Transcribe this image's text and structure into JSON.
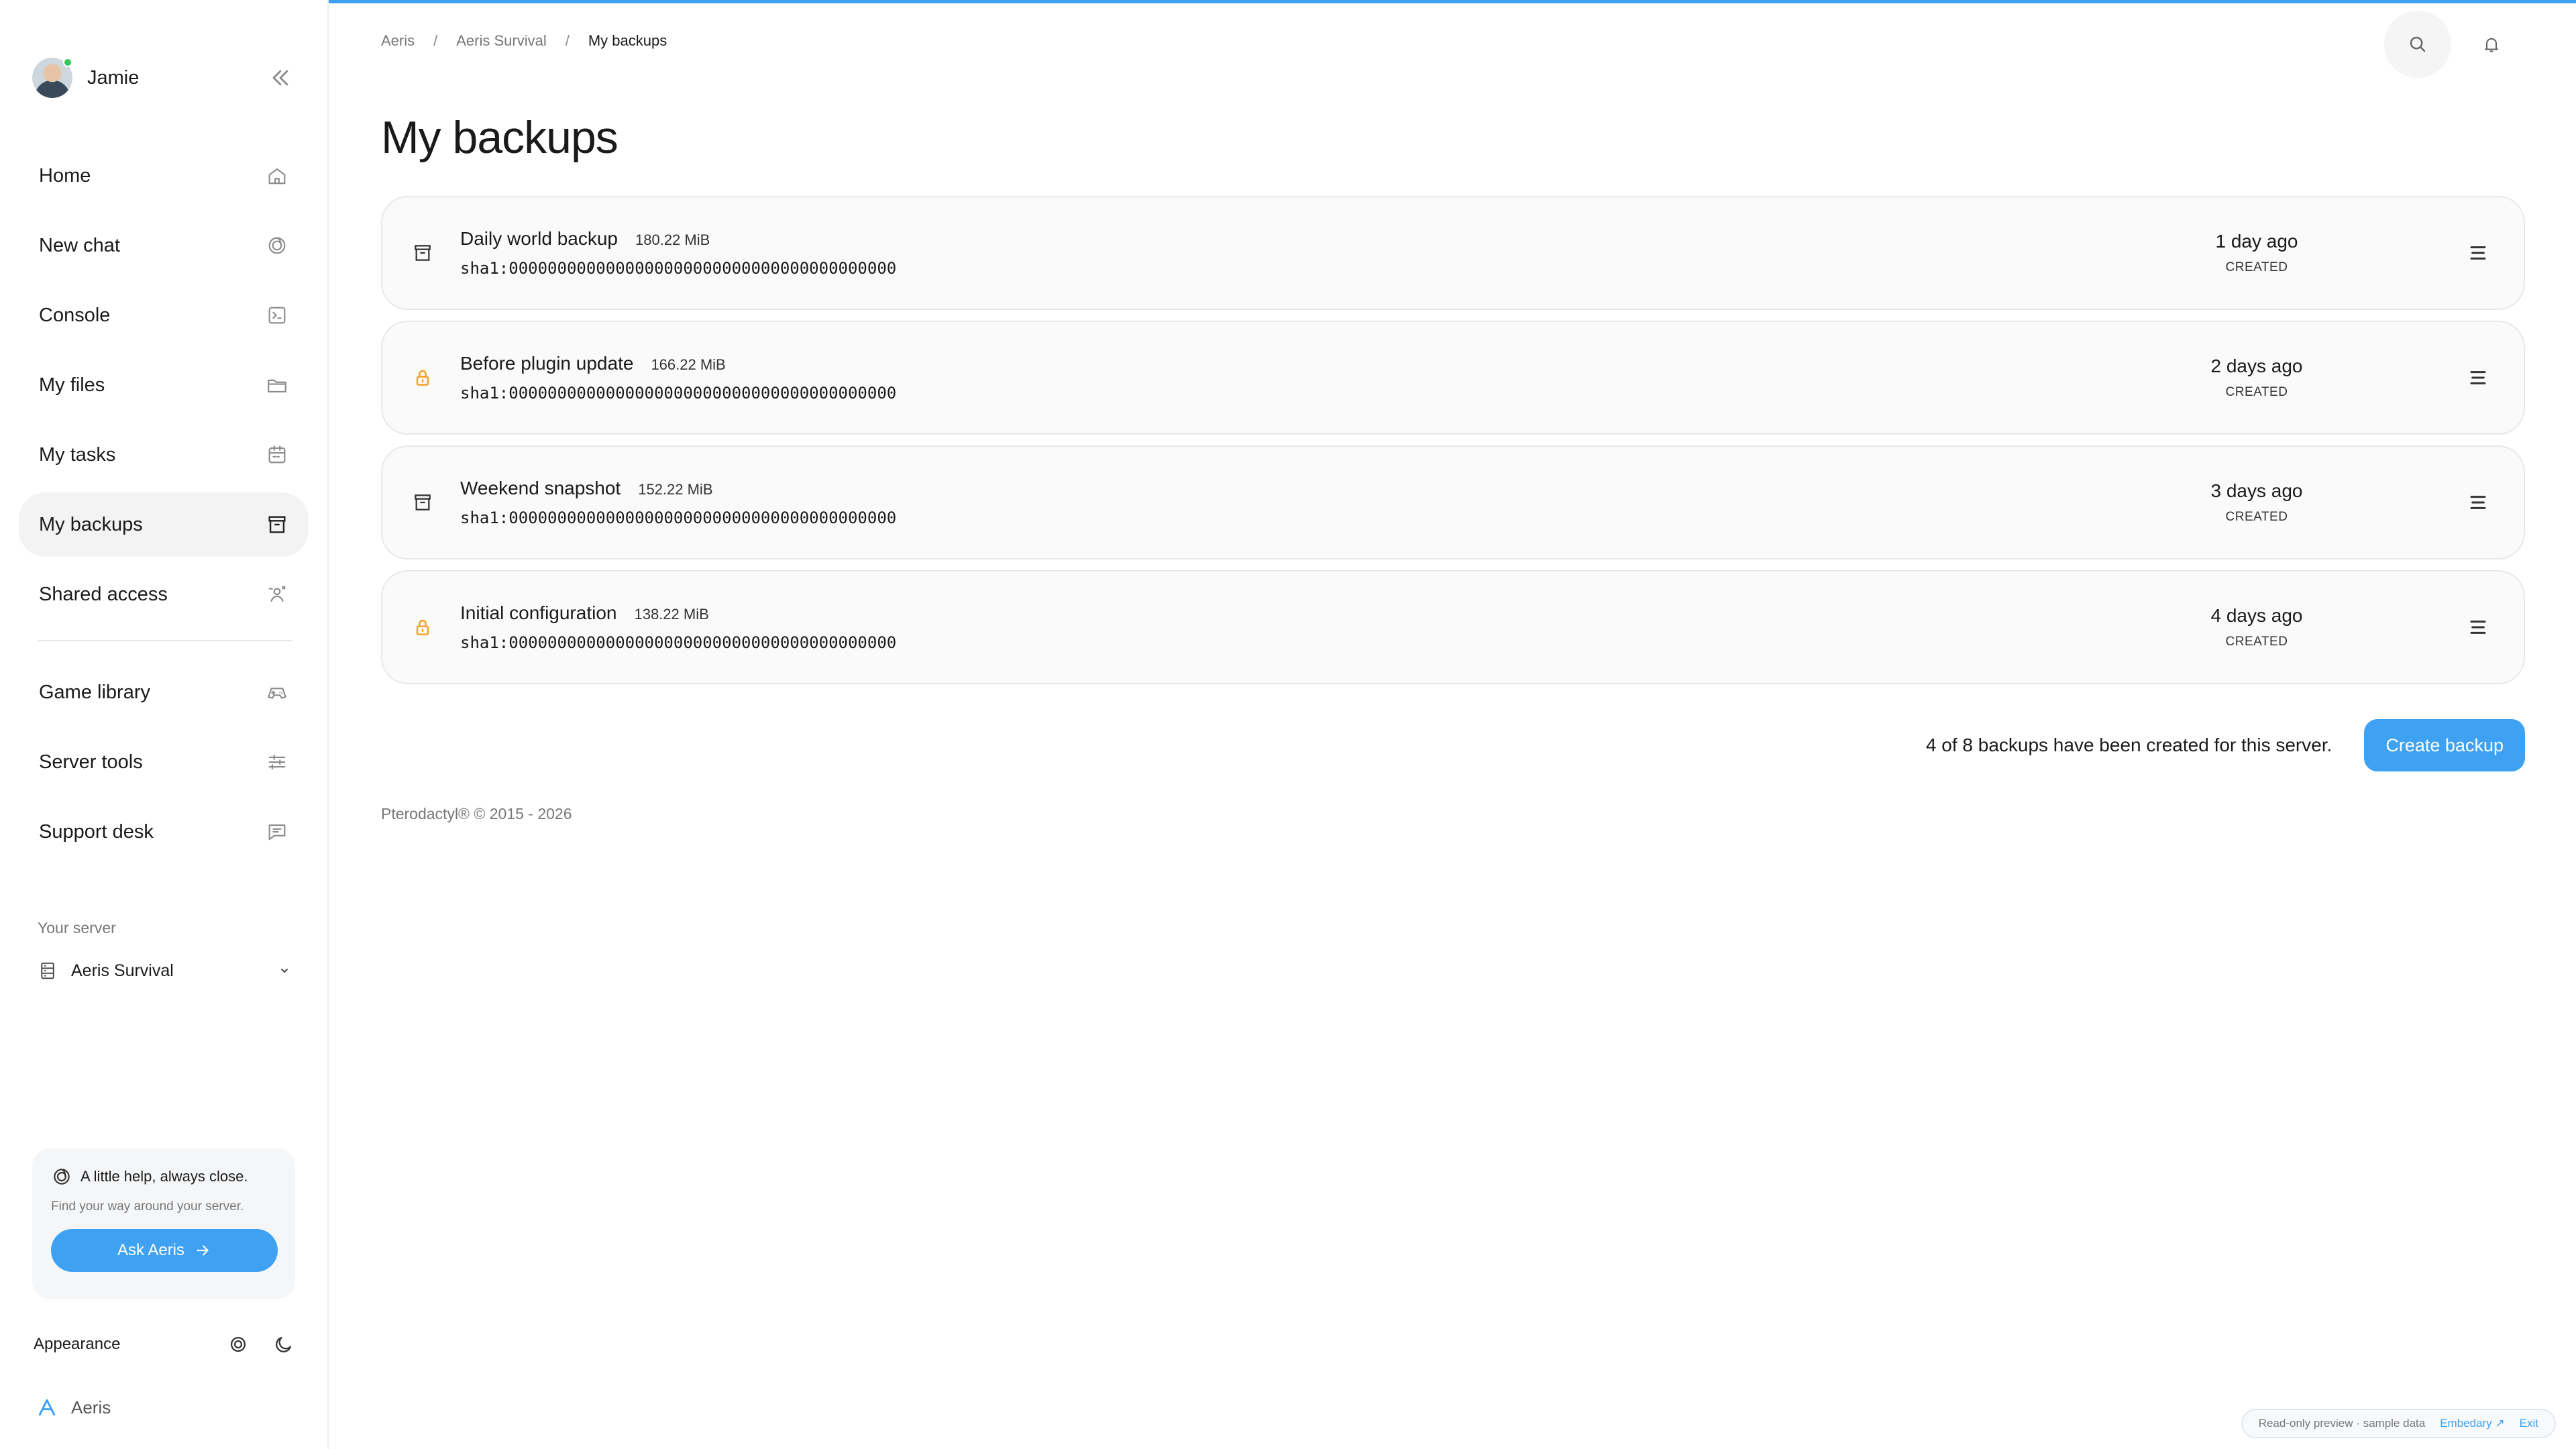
{
  "user": {
    "name": "Jamie"
  },
  "nav": {
    "items": [
      {
        "label": "Home"
      },
      {
        "label": "New chat"
      },
      {
        "label": "Console"
      },
      {
        "label": "My files"
      },
      {
        "label": "My tasks"
      },
      {
        "label": "My backups",
        "active": true
      },
      {
        "label": "Shared access"
      }
    ],
    "secondary": [
      {
        "label": "Game library"
      },
      {
        "label": "Server tools"
      },
      {
        "label": "Support desk"
      }
    ]
  },
  "server": {
    "label": "Your server",
    "name": "Aeris Survival"
  },
  "help": {
    "title": "A little help, always close.",
    "subtitle": "Find your way around your server.",
    "button": "Ask Aeris"
  },
  "appearance": {
    "label": "Appearance"
  },
  "brand": {
    "name": "Aeris"
  },
  "breadcrumb": {
    "items": [
      "Aeris",
      "Aeris Survival",
      "My backups"
    ],
    "separator": "/"
  },
  "page": {
    "title": "My backups"
  },
  "backups": [
    {
      "name": "Daily world backup",
      "size": "180.22 MiB",
      "hash": "sha1:0000000000000000000000000000000000000000",
      "when": "1 day ago",
      "status": "CREATED",
      "locked": false
    },
    {
      "name": "Before plugin update",
      "size": "166.22 MiB",
      "hash": "sha1:0000000000000000000000000000000000000000",
      "when": "2 days ago",
      "status": "CREATED",
      "locked": true
    },
    {
      "name": "Weekend snapshot",
      "size": "152.22 MiB",
      "hash": "sha1:0000000000000000000000000000000000000000",
      "when": "3 days ago",
      "status": "CREATED",
      "locked": false
    },
    {
      "name": "Initial configuration",
      "size": "138.22 MiB",
      "hash": "sha1:0000000000000000000000000000000000000000",
      "when": "4 days ago",
      "status": "CREATED",
      "locked": true
    }
  ],
  "summary": {
    "text": "4 of 8 backups have been created for this server.",
    "create_label": "Create backup"
  },
  "footer": {
    "copyright": "Pterodactyl® © 2015 - 2026"
  },
  "preview": {
    "text": "Read-only preview · sample data",
    "link": "Embedary ↗",
    "exit": "Exit"
  },
  "colors": {
    "accent": "#3ea1f2",
    "lock": "#f3a021",
    "online": "#34c759"
  }
}
